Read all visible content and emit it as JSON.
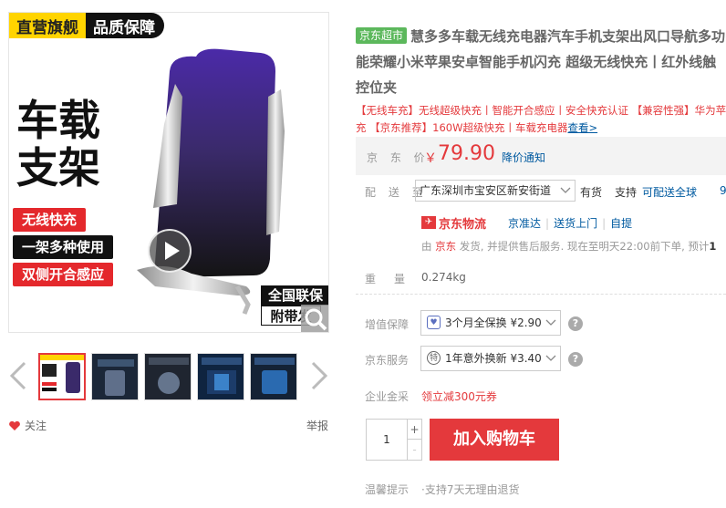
{
  "gallery": {
    "badge_left": "直营旗舰",
    "badge_right": "品质保障",
    "headline_line1": "车载",
    "headline_line2": "支架",
    "features": [
      "无线快充",
      "一架多种使用",
      "双侧开合感应"
    ],
    "corner_line1": "全国联保",
    "corner_line2": "附带发",
    "follow_label": "关注",
    "report_label": "举报"
  },
  "product": {
    "store_tag": "京东超市",
    "title": "慧多多车载无线充电器汽车手机支架出风口导航多功能荣耀小米苹果安卓智能手机闪充 超级无线快充丨红外线触控位夹",
    "promo_line1": "【无线车充】无线超级快充丨智能开合感应丨安全快充认证 【兼容性强】华为苹果小米无线快",
    "promo_line2_prefix": "充 【京东推荐】160W超级快充丨车载充电器",
    "promo_link": "查看>",
    "price_label": "京 东 价",
    "currency": "￥",
    "price": "79.90",
    "price_notify": "降价通知"
  },
  "delivery": {
    "label": "配 送 至",
    "address": "广东深圳市宝安区新安街道",
    "stock": "有货",
    "support_label": "支持",
    "support_link": "可配送全球",
    "more": "9",
    "carrier": "京东物流",
    "services": [
      "京准达",
      "送货上门",
      "自提"
    ],
    "ship_prefix": "由 ",
    "ship_seller": "京东",
    "ship_text": " 发货, 并提供售后服务. 现在至明天22:00前下单, 预计",
    "ship_bold": "1"
  },
  "specs": {
    "weight_label": "重量",
    "weight_value": "0.274kg"
  },
  "services": {
    "warranty_label": "增值保障",
    "warranty_option": "3个月全保换 ¥2.90",
    "jd_service_label": "京东服务",
    "jd_service_option": "1年意外换新 ¥3.40",
    "jd_service_icon_text": "特",
    "finance_label": "企业金采",
    "finance_value": "领立减300元券"
  },
  "cart": {
    "quantity": "1",
    "plus": "+",
    "minus": "-",
    "add_to_cart": "加入购物车",
    "tips_label": "温馨提示",
    "tips_value": "·支持7天无理由退货"
  },
  "colors": {
    "accent": "#e4393c",
    "link": "#005aa0",
    "store_tag": "#5cb85c"
  }
}
